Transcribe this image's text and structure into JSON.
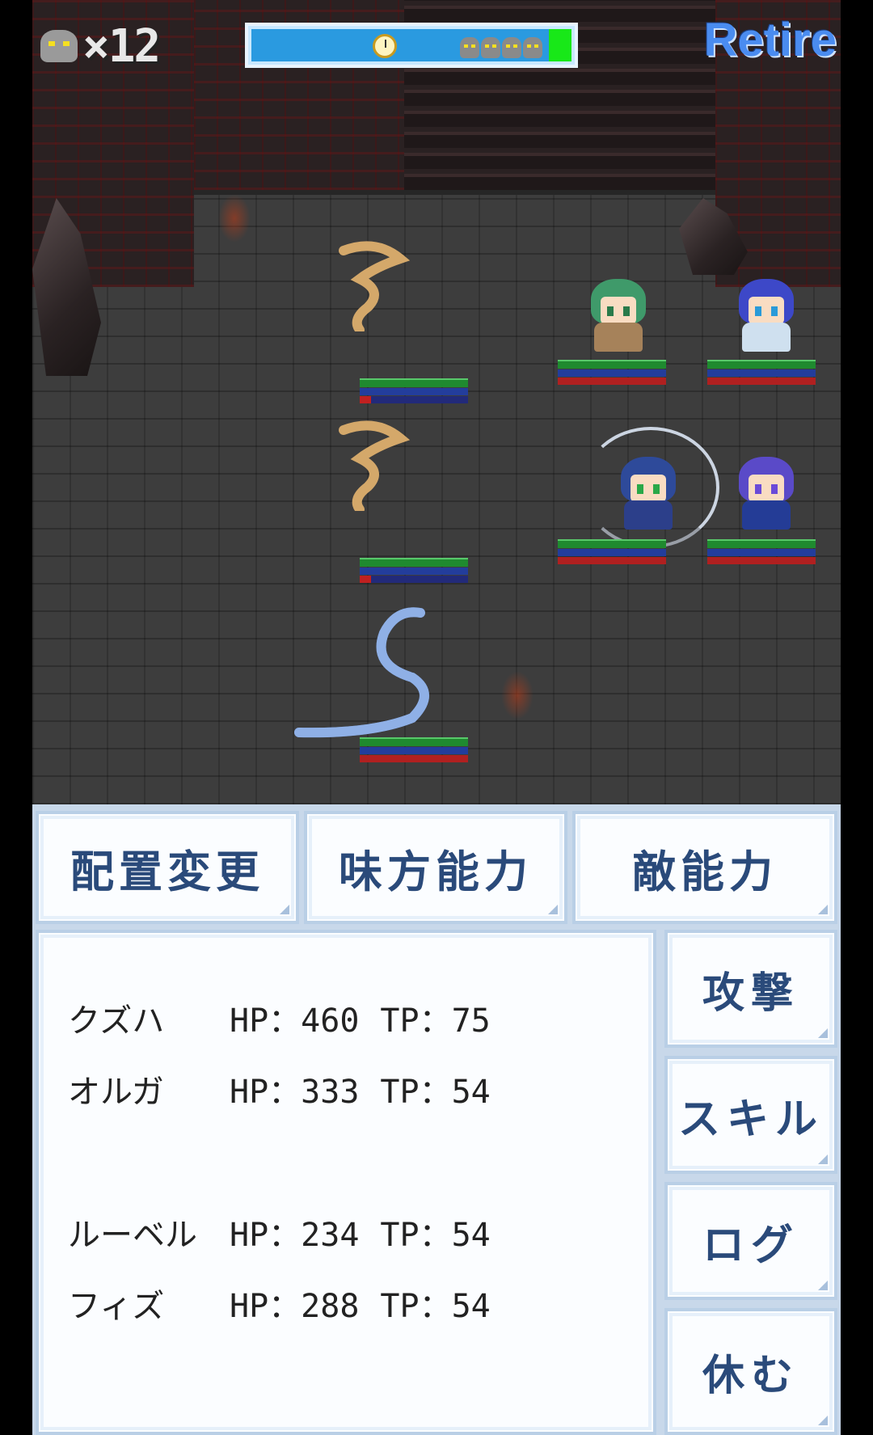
{
  "hud": {
    "enemy_icon": "monster-icon",
    "enemy_count": "×12",
    "timer_icon": "stopwatch-icon",
    "retire_label": "Retire"
  },
  "menu": {
    "formation_label": "配置変更",
    "ally_ability_label": "味方能力",
    "enemy_ability_label": "敵能力"
  },
  "status": [
    {
      "name": "クズハ",
      "hp": "HP：460",
      "tp": "TP：75"
    },
    {
      "name": "オルガ",
      "hp": "HP：333",
      "tp": "TP：54"
    },
    {
      "name": "ルーベル",
      "hp": "HP：234",
      "tp": "TP：54"
    },
    {
      "name": "フィズ",
      "hp": "HP：288",
      "tp": "TP：54"
    }
  ],
  "commands": {
    "attack_label": "攻撃",
    "skill_label": "スキル",
    "log_label": "ログ",
    "rest_label": "休む"
  },
  "colors": {
    "panel_text": "#2a4a7a",
    "retire": "#4a8cf0",
    "tp_bar": "#1f8a2f",
    "mp_bar": "#233d9c",
    "hp_bar": "#b02020"
  }
}
